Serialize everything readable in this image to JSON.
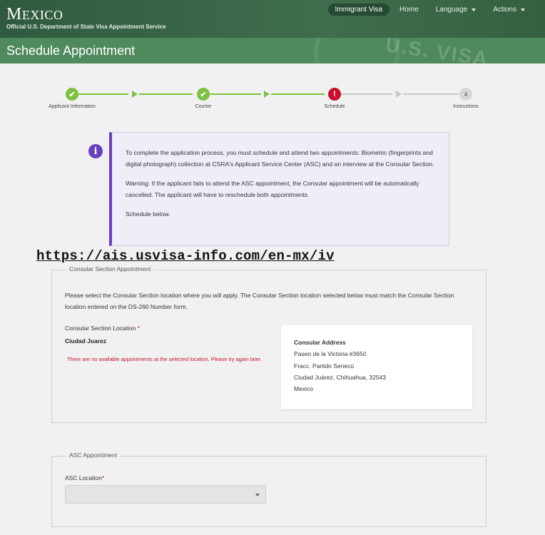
{
  "header": {
    "country_first": "M",
    "country_rest": "EXICO",
    "subtitle": "Official U.S. Department of State Visa Appointment Service",
    "nav": [
      {
        "label": "Immigrant Visa",
        "active": true,
        "dropdown": false
      },
      {
        "label": "Home",
        "active": false,
        "dropdown": false
      },
      {
        "label": "Language",
        "active": false,
        "dropdown": true
      },
      {
        "label": "Actions",
        "active": false,
        "dropdown": true
      }
    ]
  },
  "page": {
    "title": "Schedule Appointment",
    "watermark": "U.S. VISA"
  },
  "stepper": {
    "steps": [
      {
        "label": "Applicant Information",
        "state": "done",
        "glyph": "✔"
      },
      {
        "label": "Courier",
        "state": "done",
        "glyph": "✔"
      },
      {
        "label": "Schedule",
        "state": "error",
        "glyph": "!"
      },
      {
        "label": "Instructions",
        "state": "todo",
        "glyph": "4"
      }
    ],
    "colors": {
      "done": "#7cc142",
      "error": "#c8102e",
      "todo": "#d6d6d6"
    }
  },
  "info": {
    "icon": "i",
    "paragraphs": [
      "To complete the application process, you must schedule and attend two appointments: Biometric (fingerprints and digital photograph) collection at CSRA's Applicant Service Center (ASC) and an interview at the Consular Section.",
      "Warning: If the applicant fails to attend the ASC appointment, the Consular appointment will be automatically cancelled. The applicant will have to reschedule both appointments.",
      "Schedule below."
    ]
  },
  "overlay_url": "https://ais.usvisa-info.com/en-mx/iv",
  "consular": {
    "legend": "Consular Section Appointment",
    "intro": "Please select the Consular Section location where you will apply. The Consular Section location selected below must match the Consular Section location entered on the DS-260 Number form.",
    "location_label": "Consular Section Location",
    "required_mark": "*",
    "location_value": "Ciudad Juarez",
    "error": "There are no available appointments at the selected location. Please try again later.",
    "address": {
      "title": "Consular Address",
      "lines": [
        "Paseo de la Victoria #3650",
        "Fracc. Partido Senecú",
        "Ciudad Juárez, Chihuahua, 32543",
        "Mexico"
      ]
    }
  },
  "asc": {
    "legend": "ASC Appointment",
    "location_label": "ASC Location",
    "required_mark": "*",
    "selected_value": ""
  }
}
